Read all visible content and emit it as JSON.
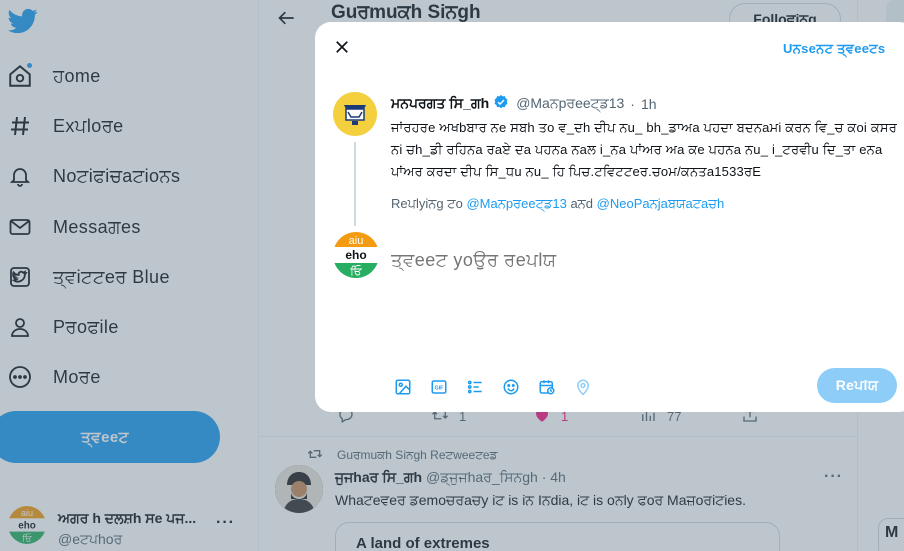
{
  "nav": {
    "items": [
      {
        "label": "ਹome",
        "icon": "home-icon"
      },
      {
        "label": "Exਪloਰe",
        "icon": "hashtag-icon"
      },
      {
        "label": "Noਟiਫiਚaਟioਨs",
        "icon": "bell-icon"
      },
      {
        "label": "Messaਗes",
        "icon": "mail-icon"
      },
      {
        "label": "ਤ੍ਵiਟਟeਰ Blue",
        "icon": "twitter-blue-icon"
      },
      {
        "label": "Pਰoਫile",
        "icon": "profile-icon"
      },
      {
        "label": "Moਰe",
        "icon": "more-circle-icon"
      }
    ],
    "tweet_button": "ਤ੍ਵeeਟ"
  },
  "account": {
    "name": "ਅਗਰ h ਦਲਸ਼h ਸe ਪਜ...",
    "handle": "@eਟਪhoਰ",
    "more": "···"
  },
  "feed": {
    "title": "Guਰmuਕh Siਨgh",
    "follow": "Folloਵiਨg",
    "actions": {
      "reply": "",
      "retweet": "1",
      "like": "1",
      "views": "77"
    },
    "retweeted_by": "Guਰmuਕh Siਨgh Reਟweeਟeਡ",
    "tweet": {
      "name": "ਜੁਜhaਰ ਸਿ_ਗh",
      "handle": "@ਡ੍ਜੁਜhaਰ_ਸਿਨgh",
      "time": "4h",
      "text": "Whaਟeਵeਰ ਡemoਚਰaਚy iਟ is iਨ Iਨdia, iਟ is oਨly ਫoਰ Maਜ਼oਰiਟies.",
      "card_title": "A land of extremes"
    }
  },
  "modal": {
    "unsent": "Uਨseਨਟ ਤ੍ਵeeਟs",
    "original": {
      "name": "ਮਨਪਰਗਤ ਸਿ_ਗh",
      "handle": "@Maਨpਰeeਟ੍ਡ13",
      "time": "1h",
      "text": "ਜਾਂਰਹਰe ਅਖbਬਾਰ ਨe ਸਬh ਤo ਵ_ਦh ਦੀਪ ਨu_ bh_ਡਾਅa ਪਹਦਾ ਬਦਨaਮi ਕਰਨ ਵਿ_ਚ ਕoi ਕਸਰ ਨi ਚh_ਡੀ ਰਹਿਨa ਰaਏ ਦa ਪਹਨa ਨaਲ i_ਨa ਪਾਂਅਰ ਅa ਕe ਪਹਨa ਨu_ i_ਟਰਵੀu ਦਿ_ਤਾ eਨa ਪਾਂਅਰ ਕਰਦਾ ਦੀਪ ਸਿ_ਧu ਨu_ ਹਿ ਪਿਚ.ਟਵਿਟਟeਰ.ਚoਮ/ਕਨਤa1533ਰE"
    },
    "replying_to_label": "Reਪlyiਨg ਟo",
    "replying_to_user1": "@Maਨpਰeeਟ੍ਡ13",
    "replying_to_and": "aਨd",
    "replying_to_user2": "@NeoPaਨjaਬਯaਟaਚh",
    "reply_placeholder": "ਤ੍ਵeeਟ yoਉਰ ਰeਪlਯ",
    "reply_button": "Reਪlਯ",
    "toolbar": [
      "image-icon",
      "gif-icon",
      "poll-icon",
      "emoji-icon",
      "schedule-icon",
      "location-icon"
    ]
  },
  "avatar": {
    "top": "aiu",
    "mid": "eho",
    "bottom": "ਓਿ"
  },
  "colors": {
    "accent": "#1d9bf0",
    "accent_disabled": "#8ecdf8",
    "text": "#0f1419",
    "muted": "#536471",
    "overlay": "rgba(91,112,131,0.40)"
  }
}
